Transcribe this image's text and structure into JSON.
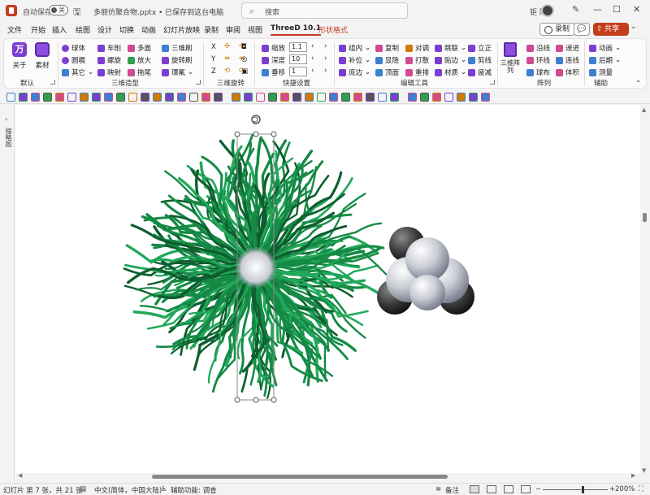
{
  "titlebar": {
    "autosave_label": "自动保存",
    "toggle_state": "关",
    "doc_name": "多丽仿聚合物.pptx • 已保存到这台电脑",
    "search_placeholder": "搜索",
    "user_name": "钜 陈"
  },
  "tabs": [
    {
      "label": "文件"
    },
    {
      "label": "开始"
    },
    {
      "label": "插入"
    },
    {
      "label": "绘图"
    },
    {
      "label": "设计"
    },
    {
      "label": "切换"
    },
    {
      "label": "动画"
    },
    {
      "label": "幻灯片放映"
    },
    {
      "label": "录制"
    },
    {
      "label": "审阅"
    },
    {
      "label": "视图"
    },
    {
      "label": "ThreeD 10.1"
    },
    {
      "label": "形状格式"
    }
  ],
  "tab_actions": {
    "record": "录制",
    "share": "共享"
  },
  "ribbon": {
    "default_group": {
      "about": "关于",
      "material": "素材",
      "label": "默认"
    },
    "model_group": {
      "label": "三维造型",
      "items": [
        "球体",
        "车削",
        "多面",
        "三维刷",
        "圆榥",
        "螺旋",
        "放大",
        "旋转刷",
        "其它",
        "映射",
        "拖尾",
        "環氟"
      ]
    },
    "rotate_group": {
      "label": "三维旋转",
      "items": [
        "X",
        "Y",
        "Z"
      ]
    },
    "quick_group": {
      "label": "快捷设置",
      "scale_label": "缩放",
      "scale_value": "1.1",
      "depth_label": "深度",
      "depth_value": "10",
      "shift_label": "垂移",
      "shift_value": "1"
    },
    "edit_group": {
      "label": "编辑工具",
      "items": [
        "组内",
        "复制",
        "对调",
        "跳联",
        "立正",
        "补位",
        "显隐",
        "打散",
        "贴边",
        "剪线",
        "庞边",
        "顶面",
        "重排",
        "材质",
        "疲减"
      ]
    },
    "array_group": {
      "label": "阵列",
      "array3d": "三维阵列",
      "items": [
        "沿线",
        "环线",
        "球布",
        "速进",
        "连线",
        "体积"
      ]
    },
    "assist_group": {
      "label": "辅助",
      "items": [
        "动画",
        "后期",
        "测量"
      ]
    }
  },
  "thumbstrip": {
    "label": "缩略图"
  },
  "statusbar": {
    "slide_info": "幻灯片 第 7 张，共 21 张",
    "language": "中文(简体，中国大陆)",
    "accessibility": "辅助功能: 调查",
    "notes": "备注",
    "zoom": "200%"
  },
  "colors": {
    "accent": "#c43e1c",
    "fiber_dark": "#0d5e2e",
    "fiber_mid": "#148a45",
    "fiber_light": "#22a85a"
  }
}
